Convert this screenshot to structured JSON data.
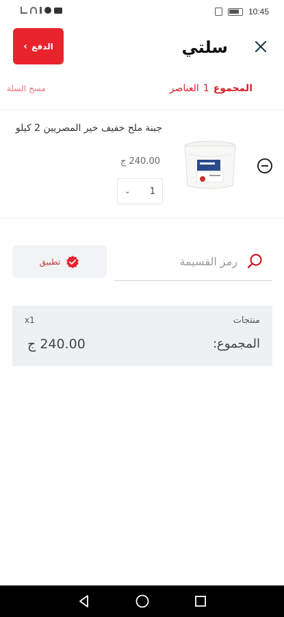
{
  "status_bar": {
    "time": "10:45"
  },
  "header": {
    "title": "سلتي",
    "pay_label": "الدفع",
    "close_icon": "close-icon"
  },
  "cart": {
    "clear_label": "مسح السلة",
    "total_label": "المجموع",
    "items_count": "1",
    "items_label": "العناصر"
  },
  "product": {
    "name": "جبنة ملح خفيف خير المصريين 2 كيلو",
    "price": "240.00 ج",
    "quantity": "1",
    "image_icon": "cheese-tub-image",
    "remove_icon": "minus-circle-icon"
  },
  "coupon": {
    "placeholder": "رمز القسيمة",
    "apply_label": "تطبيق",
    "apply_icon": "verified-badge-icon",
    "search_icon": "search-icon"
  },
  "summary": {
    "products_label": "منتجات",
    "count": "x1",
    "total_label": "المجموع:",
    "total_value": "240.00 ج"
  },
  "colors": {
    "accent": "#e8232c",
    "summary_bg": "#eef0f3",
    "close_icon": "#1f3b4d"
  }
}
